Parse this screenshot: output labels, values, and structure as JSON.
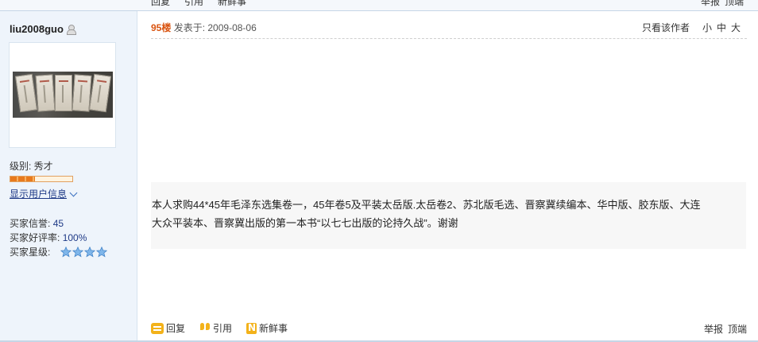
{
  "previous_post": {
    "actions": [
      "回复",
      "引用",
      "新鲜事"
    ],
    "right_actions": [
      "举报",
      "顶端"
    ]
  },
  "user": {
    "name": "liu2008guo",
    "level_label": "级别: 秀才",
    "show_info_label": "显示用户信息",
    "stats": [
      {
        "label": "买家信誉:",
        "value": "45"
      },
      {
        "label": "买家好评率:",
        "value": "100%"
      },
      {
        "label": "买家星级:",
        "value": ""
      }
    ],
    "star_count": 4,
    "level_progress": 0.4
  },
  "post": {
    "floor": "95楼",
    "posted_label": "发表于: 2009-08-06",
    "only_author_label": "只看该作者",
    "font_sizes": [
      "小",
      "中",
      "大"
    ],
    "body_line_1": "本人求购44*45年毛泽东选集卷一，45年卷5及平装太岳版.太岳卷2、苏北版毛选、晋察冀续编本、华中版、胶东版、大连",
    "body_line_2": "大众平装本、晋察冀出版的第一本书“以七七出版的论持久战”。谢谢"
  },
  "actions": {
    "reply": "回复",
    "quote": "引用",
    "news": "新鲜事",
    "report": "举报",
    "top": "顶端"
  },
  "colors": {
    "sidebar_bg": "#eef4fb",
    "floor": "#d9530f",
    "link": "#1f3a87",
    "icon_accent": "#f3b21a",
    "body_bg": "#f7f7f7"
  }
}
